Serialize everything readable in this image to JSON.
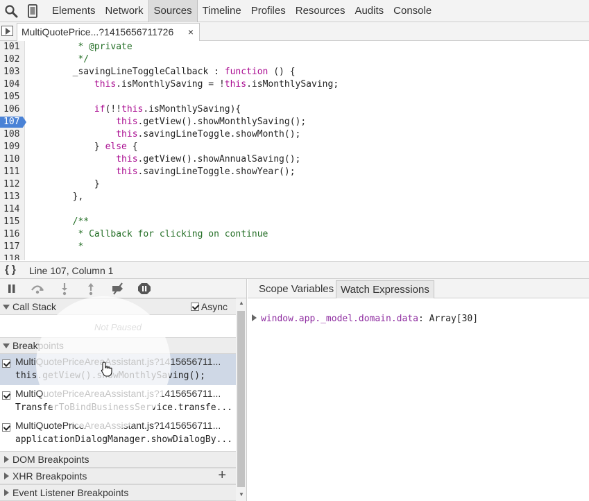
{
  "toolbar": {
    "tabs": [
      {
        "label": "Elements"
      },
      {
        "label": "Network"
      },
      {
        "label": "Sources",
        "active": true
      },
      {
        "label": "Timeline"
      },
      {
        "label": "Profiles"
      },
      {
        "label": "Resources"
      },
      {
        "label": "Audits"
      },
      {
        "label": "Console"
      }
    ],
    "icons": [
      "search-icon",
      "device-mode-icon"
    ]
  },
  "file_tab": {
    "label": "MultiQuotePrice...?1415656711726",
    "close_glyph": "×"
  },
  "editor": {
    "lines": [
      {
        "num": "101",
        "text": "         * @private"
      },
      {
        "num": "102",
        "text": "         */"
      },
      {
        "num": "103",
        "text": "        _savingLineToggleCallback : function () {"
      },
      {
        "num": "104",
        "text": "            this.isMonthlySaving = !this.isMonthlySaving;"
      },
      {
        "num": "105",
        "text": ""
      },
      {
        "num": "106",
        "text": "            if(!!this.isMonthlySaving){"
      },
      {
        "num": "107",
        "text": "                this.getView().showMonthlySaving();",
        "breakpoint": true
      },
      {
        "num": "108",
        "text": "                this.savingLineToggle.showMonth();"
      },
      {
        "num": "109",
        "text": "            } else {"
      },
      {
        "num": "110",
        "text": "                this.getView().showAnnualSaving();"
      },
      {
        "num": "111",
        "text": "                this.savingLineToggle.showYear();"
      },
      {
        "num": "112",
        "text": "            }"
      },
      {
        "num": "113",
        "text": "        },"
      },
      {
        "num": "114",
        "text": ""
      },
      {
        "num": "115",
        "text": "        /**"
      },
      {
        "num": "116",
        "text": "         * Callback for clicking on continue"
      },
      {
        "num": "117",
        "text": "         *"
      },
      {
        "num": "118",
        "text": ""
      }
    ]
  },
  "status": {
    "braces": "{ }",
    "position": "Line 107, Column 1"
  },
  "debugger": {
    "controls": [
      "pause-icon",
      "step-over-icon",
      "step-into-icon",
      "step-out-icon",
      "deactivate-breakpoints-icon",
      "pause-on-exceptions-icon"
    ],
    "call_stack": {
      "title": "Call Stack",
      "async_label": "Async",
      "not_paused": "Not Paused"
    },
    "breakpoints": {
      "title": "Breakpoints",
      "items": [
        {
          "file": "MultiQuotePriceAreaAssistant.js?1415656711...",
          "snippet": "this.getView().showMonthlySaving();",
          "checked": true
        },
        {
          "file": "MultiQuotePriceAreaAssistant.js?1415656711...",
          "snippet": "TransferToBindBusinessService.transfe...",
          "checked": true
        },
        {
          "file": "MultiQuotePriceAreaAssistant.js?1415656711...",
          "snippet": "applicationDialogManager.showDialogBy...",
          "checked": true
        }
      ]
    },
    "dom_breakpoints": "DOM Breakpoints",
    "xhr_breakpoints": "XHR Breakpoints",
    "xhr_add": "+",
    "event_listener_breakpoints": "Event Listener Breakpoints"
  },
  "right_pane": {
    "tabs": [
      {
        "label": "Scope Variables"
      },
      {
        "label": "Watch Expressions",
        "active": true
      }
    ],
    "watch": {
      "expression": "window.app._model.domain.data",
      "separator": ": ",
      "value": "Array[30]"
    }
  },
  "colors": {
    "breakpoint": "#4a82d6",
    "keyword": "#aa0d91",
    "comment": "#236e25"
  }
}
